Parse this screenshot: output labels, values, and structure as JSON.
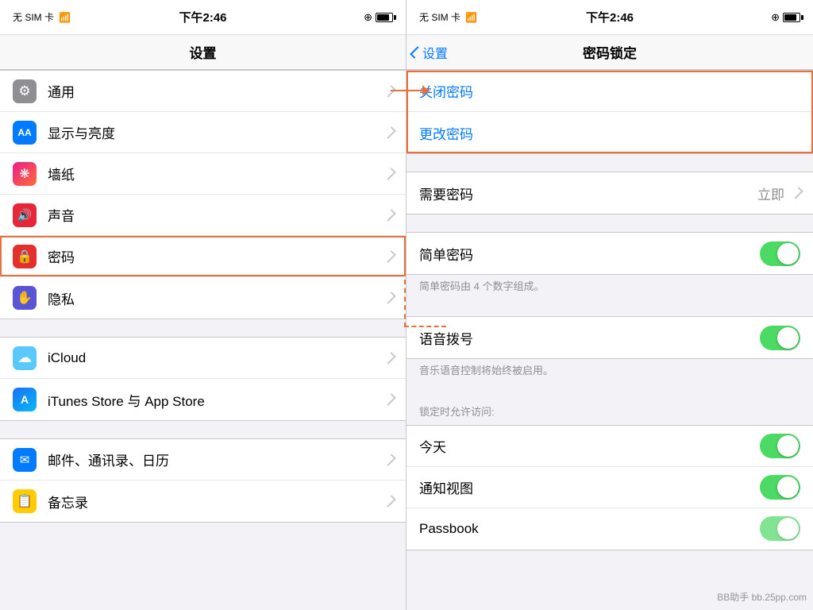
{
  "left_panel": {
    "status_bar": {
      "carrier": "无 SIM 卡",
      "wifi": "WiFi",
      "time": "下午2:46",
      "brightness": "●",
      "battery": ""
    },
    "nav_title": "设置",
    "sections": [
      {
        "id": "general-section",
        "items": [
          {
            "id": "general",
            "icon_type": "gray",
            "icon_char": "⚙",
            "label": "通用",
            "highlighted": false
          },
          {
            "id": "display",
            "icon_type": "blue",
            "icon_char": "AA",
            "label": "显示与亮度",
            "highlighted": false
          },
          {
            "id": "wallpaper",
            "icon_type": "pink",
            "icon_char": "❋",
            "label": "墙纸",
            "highlighted": false
          },
          {
            "id": "sound",
            "icon_type": "red-sound",
            "icon_char": "🔊",
            "label": "声音",
            "highlighted": false
          },
          {
            "id": "passcode",
            "icon_type": "red",
            "icon_char": "🔒",
            "label": "密码",
            "highlighted": true
          },
          {
            "id": "privacy",
            "icon_type": "privacy",
            "icon_char": "✋",
            "label": "隐私",
            "highlighted": false
          }
        ]
      },
      {
        "id": "cloud-section",
        "items": [
          {
            "id": "icloud",
            "icon_type": "teal",
            "icon_char": "☁",
            "label": "iCloud",
            "highlighted": false
          },
          {
            "id": "itunes",
            "icon_type": "appstore",
            "icon_char": "A",
            "label": "iTunes Store 与 App Store",
            "highlighted": false
          }
        ]
      },
      {
        "id": "apps-section",
        "items": [
          {
            "id": "mail",
            "icon_type": "mail",
            "icon_char": "✉",
            "label": "邮件、通讯录、日历",
            "highlighted": false
          },
          {
            "id": "notes",
            "icon_type": "notes",
            "icon_char": "📝",
            "label": "备忘录",
            "highlighted": false
          }
        ]
      }
    ]
  },
  "right_panel": {
    "status_bar": {
      "carrier": "无 SIM 卡",
      "wifi": "WiFi",
      "time": "下午2:46",
      "brightness": "●",
      "battery": ""
    },
    "nav_back": "设置",
    "nav_title": "密码锁定",
    "items": [
      {
        "id": "turn-off",
        "label": "关闭密码",
        "type": "action",
        "highlighted": true
      },
      {
        "id": "change",
        "label": "更改密码",
        "type": "action",
        "highlighted": false
      }
    ],
    "settings_rows": [
      {
        "id": "require",
        "label": "需要密码",
        "value": "立即",
        "type": "value-chevron"
      },
      {
        "id": "simple",
        "label": "简单密码",
        "type": "toggle",
        "enabled": true
      },
      {
        "id": "simple-desc",
        "label": "简单密码由 4 个数字组成。",
        "type": "description"
      },
      {
        "id": "voice",
        "label": "语音拨号",
        "type": "toggle",
        "enabled": true
      },
      {
        "id": "voice-desc",
        "label": "音乐语音控制将始终被启用。",
        "type": "description"
      },
      {
        "id": "access-header",
        "label": "锁定时允许访问:",
        "type": "section-header"
      },
      {
        "id": "today",
        "label": "今天",
        "type": "toggle",
        "enabled": true
      },
      {
        "id": "notification",
        "label": "通知视图",
        "type": "toggle",
        "enabled": true
      },
      {
        "id": "passbook",
        "label": "Passbook",
        "type": "toggle",
        "enabled": true
      }
    ]
  },
  "annotation": {
    "arrow_label": "→",
    "watermark": "BB助手 bb.25pp.com"
  }
}
